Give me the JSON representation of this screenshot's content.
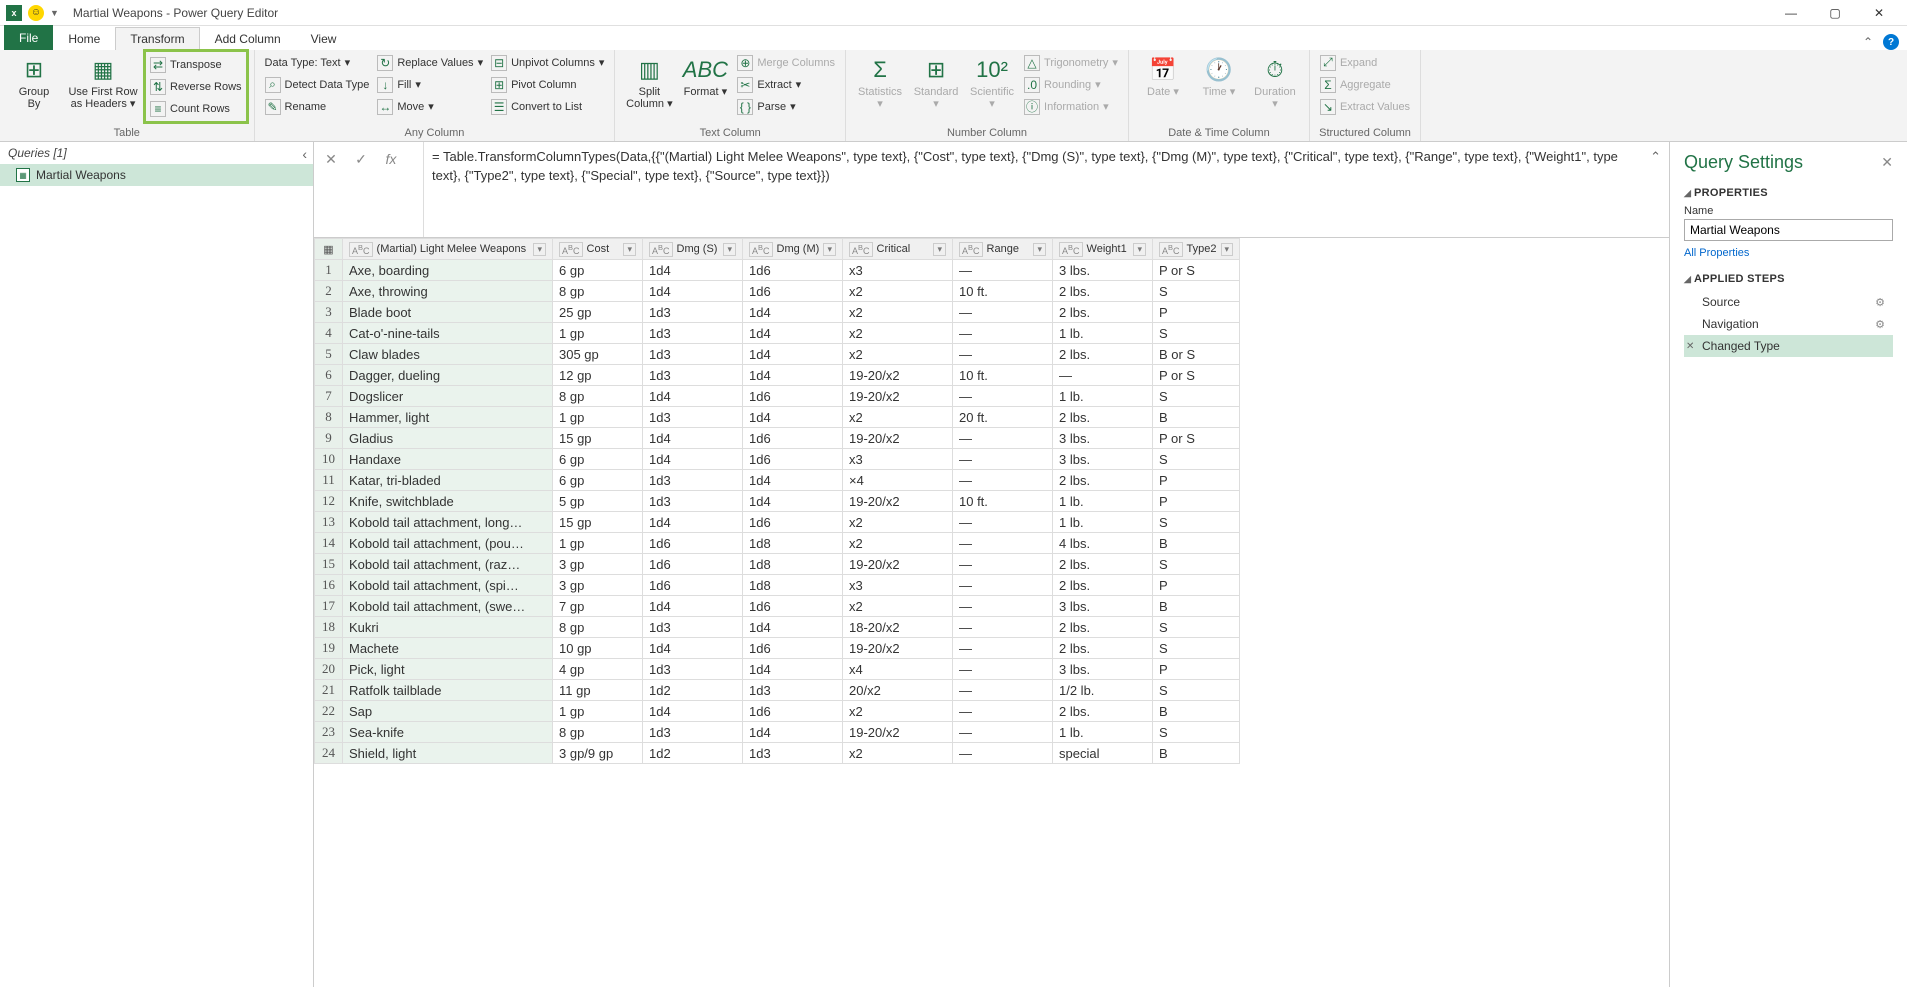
{
  "title": "Martial Weapons - Power Query Editor",
  "tabs": {
    "file": "File",
    "home": "Home",
    "transform": "Transform",
    "add_column": "Add Column",
    "view": "View"
  },
  "ribbon": {
    "table": {
      "group_by": "Group\nBy",
      "use_first": "Use First Row\nas Headers",
      "transpose": "Transpose",
      "reverse": "Reverse Rows",
      "count": "Count Rows",
      "label": "Table"
    },
    "any_column": {
      "data_type": "Data Type: Text",
      "detect": "Detect Data Type",
      "rename": "Rename",
      "replace": "Replace Values",
      "fill": "Fill",
      "move": "Move",
      "unpivot": "Unpivot Columns",
      "pivot": "Pivot Column",
      "convert": "Convert to List",
      "label": "Any Column"
    },
    "text_column": {
      "split": "Split\nColumn",
      "format": "Format",
      "merge": "Merge Columns",
      "extract": "Extract",
      "parse": "Parse",
      "label": "Text Column"
    },
    "number_column": {
      "statistics": "Statistics",
      "standard": "Standard",
      "scientific": "Scientific",
      "trig": "Trigonometry",
      "rounding": "Rounding",
      "info": "Information",
      "label": "Number Column"
    },
    "datetime_column": {
      "date": "Date",
      "time": "Time",
      "duration": "Duration",
      "label": "Date & Time Column"
    },
    "structured_column": {
      "expand": "Expand",
      "aggregate": "Aggregate",
      "extract_vals": "Extract Values",
      "label": "Structured Column"
    }
  },
  "queries": {
    "header": "Queries [1]",
    "items": [
      "Martial Weapons"
    ]
  },
  "formula": "= Table.TransformColumnTypes(Data,{{\"(Martial) Light Melee Weapons\", type text}, {\"Cost\", type text}, {\"Dmg (S)\", type text}, {\"Dmg (M)\", type text}, {\"Critical\", type text}, {\"Range\", type text}, {\"Weight1\", type text}, {\"Type2\", type text}, {\"Special\", type text}, {\"Source\", type text}})",
  "columns": [
    "(Martial) Light Melee Weapons",
    "Cost",
    "Dmg (S)",
    "Dmg (M)",
    "Critical",
    "Range",
    "Weight1",
    "Type2"
  ],
  "rows": [
    [
      "Axe, boarding",
      "6 gp",
      "1d4",
      "1d6",
      "x3",
      "—",
      "3 lbs.",
      "P or S"
    ],
    [
      "Axe, throwing",
      "8 gp",
      "1d4",
      "1d6",
      "x2",
      "10 ft.",
      "2 lbs.",
      "S"
    ],
    [
      "Blade boot",
      "25 gp",
      "1d3",
      "1d4",
      "x2",
      "—",
      "2 lbs.",
      "P"
    ],
    [
      "Cat-o'-nine-tails",
      "1 gp",
      "1d3",
      "1d4",
      "x2",
      "—",
      "1 lb.",
      "S"
    ],
    [
      "Claw blades",
      "305 gp",
      "1d3",
      "1d4",
      "x2",
      "—",
      "2 lbs.",
      "B or S"
    ],
    [
      "Dagger, dueling",
      "12 gp",
      "1d3",
      "1d4",
      "19-20/x2",
      "10 ft.",
      "—",
      "P or S"
    ],
    [
      "Dogslicer",
      "8 gp",
      "1d4",
      "1d6",
      "19-20/x2",
      "—",
      "1 lb.",
      "S"
    ],
    [
      "Hammer, light",
      "1 gp",
      "1d3",
      "1d4",
      "x2",
      "20 ft.",
      "2 lbs.",
      "B"
    ],
    [
      "Gladius",
      "15 gp",
      "1d4",
      "1d6",
      "19-20/x2",
      "—",
      "3 lbs.",
      "P or S"
    ],
    [
      "Handaxe",
      "6 gp",
      "1d4",
      "1d6",
      "x3",
      "—",
      "3 lbs.",
      "S"
    ],
    [
      "Katar, tri-bladed",
      "6 gp",
      "1d3",
      "1d4",
      "×4",
      "—",
      "2 lbs.",
      "P"
    ],
    [
      "Knife, switchblade",
      "5 gp",
      "1d3",
      "1d4",
      "19-20/x2",
      "10 ft.",
      "1 lb.",
      "P"
    ],
    [
      "Kobold tail attachment, long…",
      "15 gp",
      "1d4",
      "1d6",
      "x2",
      "—",
      "1 lb.",
      "S"
    ],
    [
      "Kobold tail attachment, (pou…",
      "1 gp",
      "1d6",
      "1d8",
      "x2",
      "—",
      "4 lbs.",
      "B"
    ],
    [
      "Kobold tail attachment, (raz…",
      "3 gp",
      "1d6",
      "1d8",
      "19-20/x2",
      "—",
      "2 lbs.",
      "S"
    ],
    [
      "Kobold tail attachment, (spi…",
      "3 gp",
      "1d6",
      "1d8",
      "x3",
      "—",
      "2 lbs.",
      "P"
    ],
    [
      "Kobold tail attachment, (swe…",
      "7 gp",
      "1d4",
      "1d6",
      "x2",
      "—",
      "3 lbs.",
      "B"
    ],
    [
      "Kukri",
      "8 gp",
      "1d3",
      "1d4",
      "18-20/x2",
      "—",
      "2 lbs.",
      "S"
    ],
    [
      "Machete",
      "10 gp",
      "1d4",
      "1d6",
      "19-20/x2",
      "—",
      "2 lbs.",
      "S"
    ],
    [
      "Pick, light",
      "4 gp",
      "1d3",
      "1d4",
      "x4",
      "—",
      "3 lbs.",
      "P"
    ],
    [
      "Ratfolk tailblade",
      "11 gp",
      "1d2",
      "1d3",
      "20/x2",
      "—",
      "1/2 lb.",
      "S"
    ],
    [
      "Sap",
      "1 gp",
      "1d4",
      "1d6",
      "x2",
      "—",
      "2 lbs.",
      "B"
    ],
    [
      "Sea-knife",
      "8 gp",
      "1d3",
      "1d4",
      "19-20/x2",
      "—",
      "1 lb.",
      "S"
    ],
    [
      "Shield, light",
      "3 gp/9 gp",
      "1d2",
      "1d3",
      "x2",
      "—",
      "special",
      "B"
    ]
  ],
  "settings": {
    "title": "Query Settings",
    "properties_head": "PROPERTIES",
    "name_label": "Name",
    "name_value": "Martial Weapons",
    "all_props": "All Properties",
    "steps_head": "APPLIED STEPS",
    "steps": [
      "Source",
      "Navigation",
      "Changed Type"
    ]
  }
}
